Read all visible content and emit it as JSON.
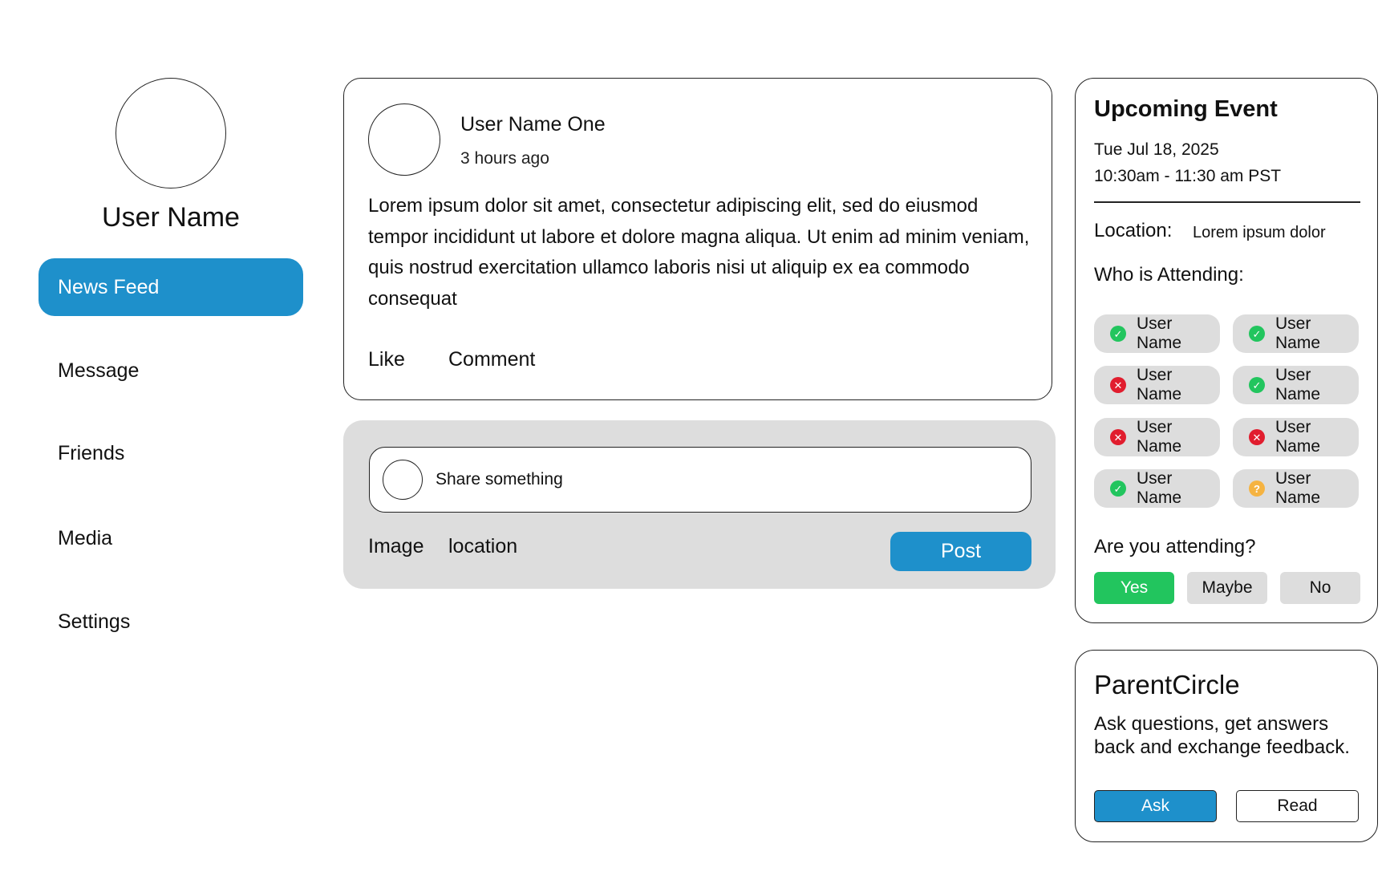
{
  "sidebar": {
    "user_name": "User Name",
    "nav": [
      {
        "label": "News Feed",
        "active": true
      },
      {
        "label": "Message",
        "active": false
      },
      {
        "label": "Friends",
        "active": false
      },
      {
        "label": "Media",
        "active": false
      },
      {
        "label": "Settings",
        "active": false
      }
    ]
  },
  "post": {
    "author": "User Name One",
    "time": "3 hours ago",
    "body": "Lorem ipsum dolor sit amet, consectetur adipiscing elit, sed do eiusmod tempor incididunt ut labore et dolore magna aliqua. Ut enim ad minim veniam, quis nostrud exercitation ullamco laboris nisi ut aliquip ex ea commodo consequat",
    "like_label": "Like",
    "comment_label": "Comment"
  },
  "composer": {
    "placeholder": "Share something",
    "image_label": "Image",
    "location_label": "location",
    "post_label": "Post"
  },
  "event": {
    "title": "Upcoming Event",
    "date": "Tue Jul 18, 2025",
    "time": "10:30am - 11:30 am PST",
    "location_label": "Location:",
    "location_value": "Lorem ipsum dolor",
    "attending_heading": "Who is Attending:",
    "attendees": [
      {
        "name": "User Name",
        "status": "yes"
      },
      {
        "name": "User Name",
        "status": "yes"
      },
      {
        "name": "User Name",
        "status": "no"
      },
      {
        "name": "User Name",
        "status": "yes"
      },
      {
        "name": "User Name",
        "status": "no"
      },
      {
        "name": "User Name",
        "status": "no"
      },
      {
        "name": "User Name",
        "status": "yes"
      },
      {
        "name": "User Name",
        "status": "maybe"
      }
    ],
    "rsvp_question": "Are you attending?",
    "rsvp_options": [
      "Yes",
      "Maybe",
      "No"
    ],
    "rsvp_selected": "Yes"
  },
  "parent_circle": {
    "title": "ParentCircle",
    "description": "Ask questions, get answers back and exchange feedback.",
    "ask_label": "Ask",
    "read_label": "Read"
  },
  "colors": {
    "accent_blue": "#1e90cb",
    "status_yes": "#22c55e",
    "status_no": "#e11d2e",
    "status_maybe": "#f5b341",
    "panel_gray": "#dddddd"
  },
  "icons": {
    "status_yes": "check-circle-icon",
    "status_no": "x-circle-icon",
    "status_maybe": "question-circle-icon"
  }
}
